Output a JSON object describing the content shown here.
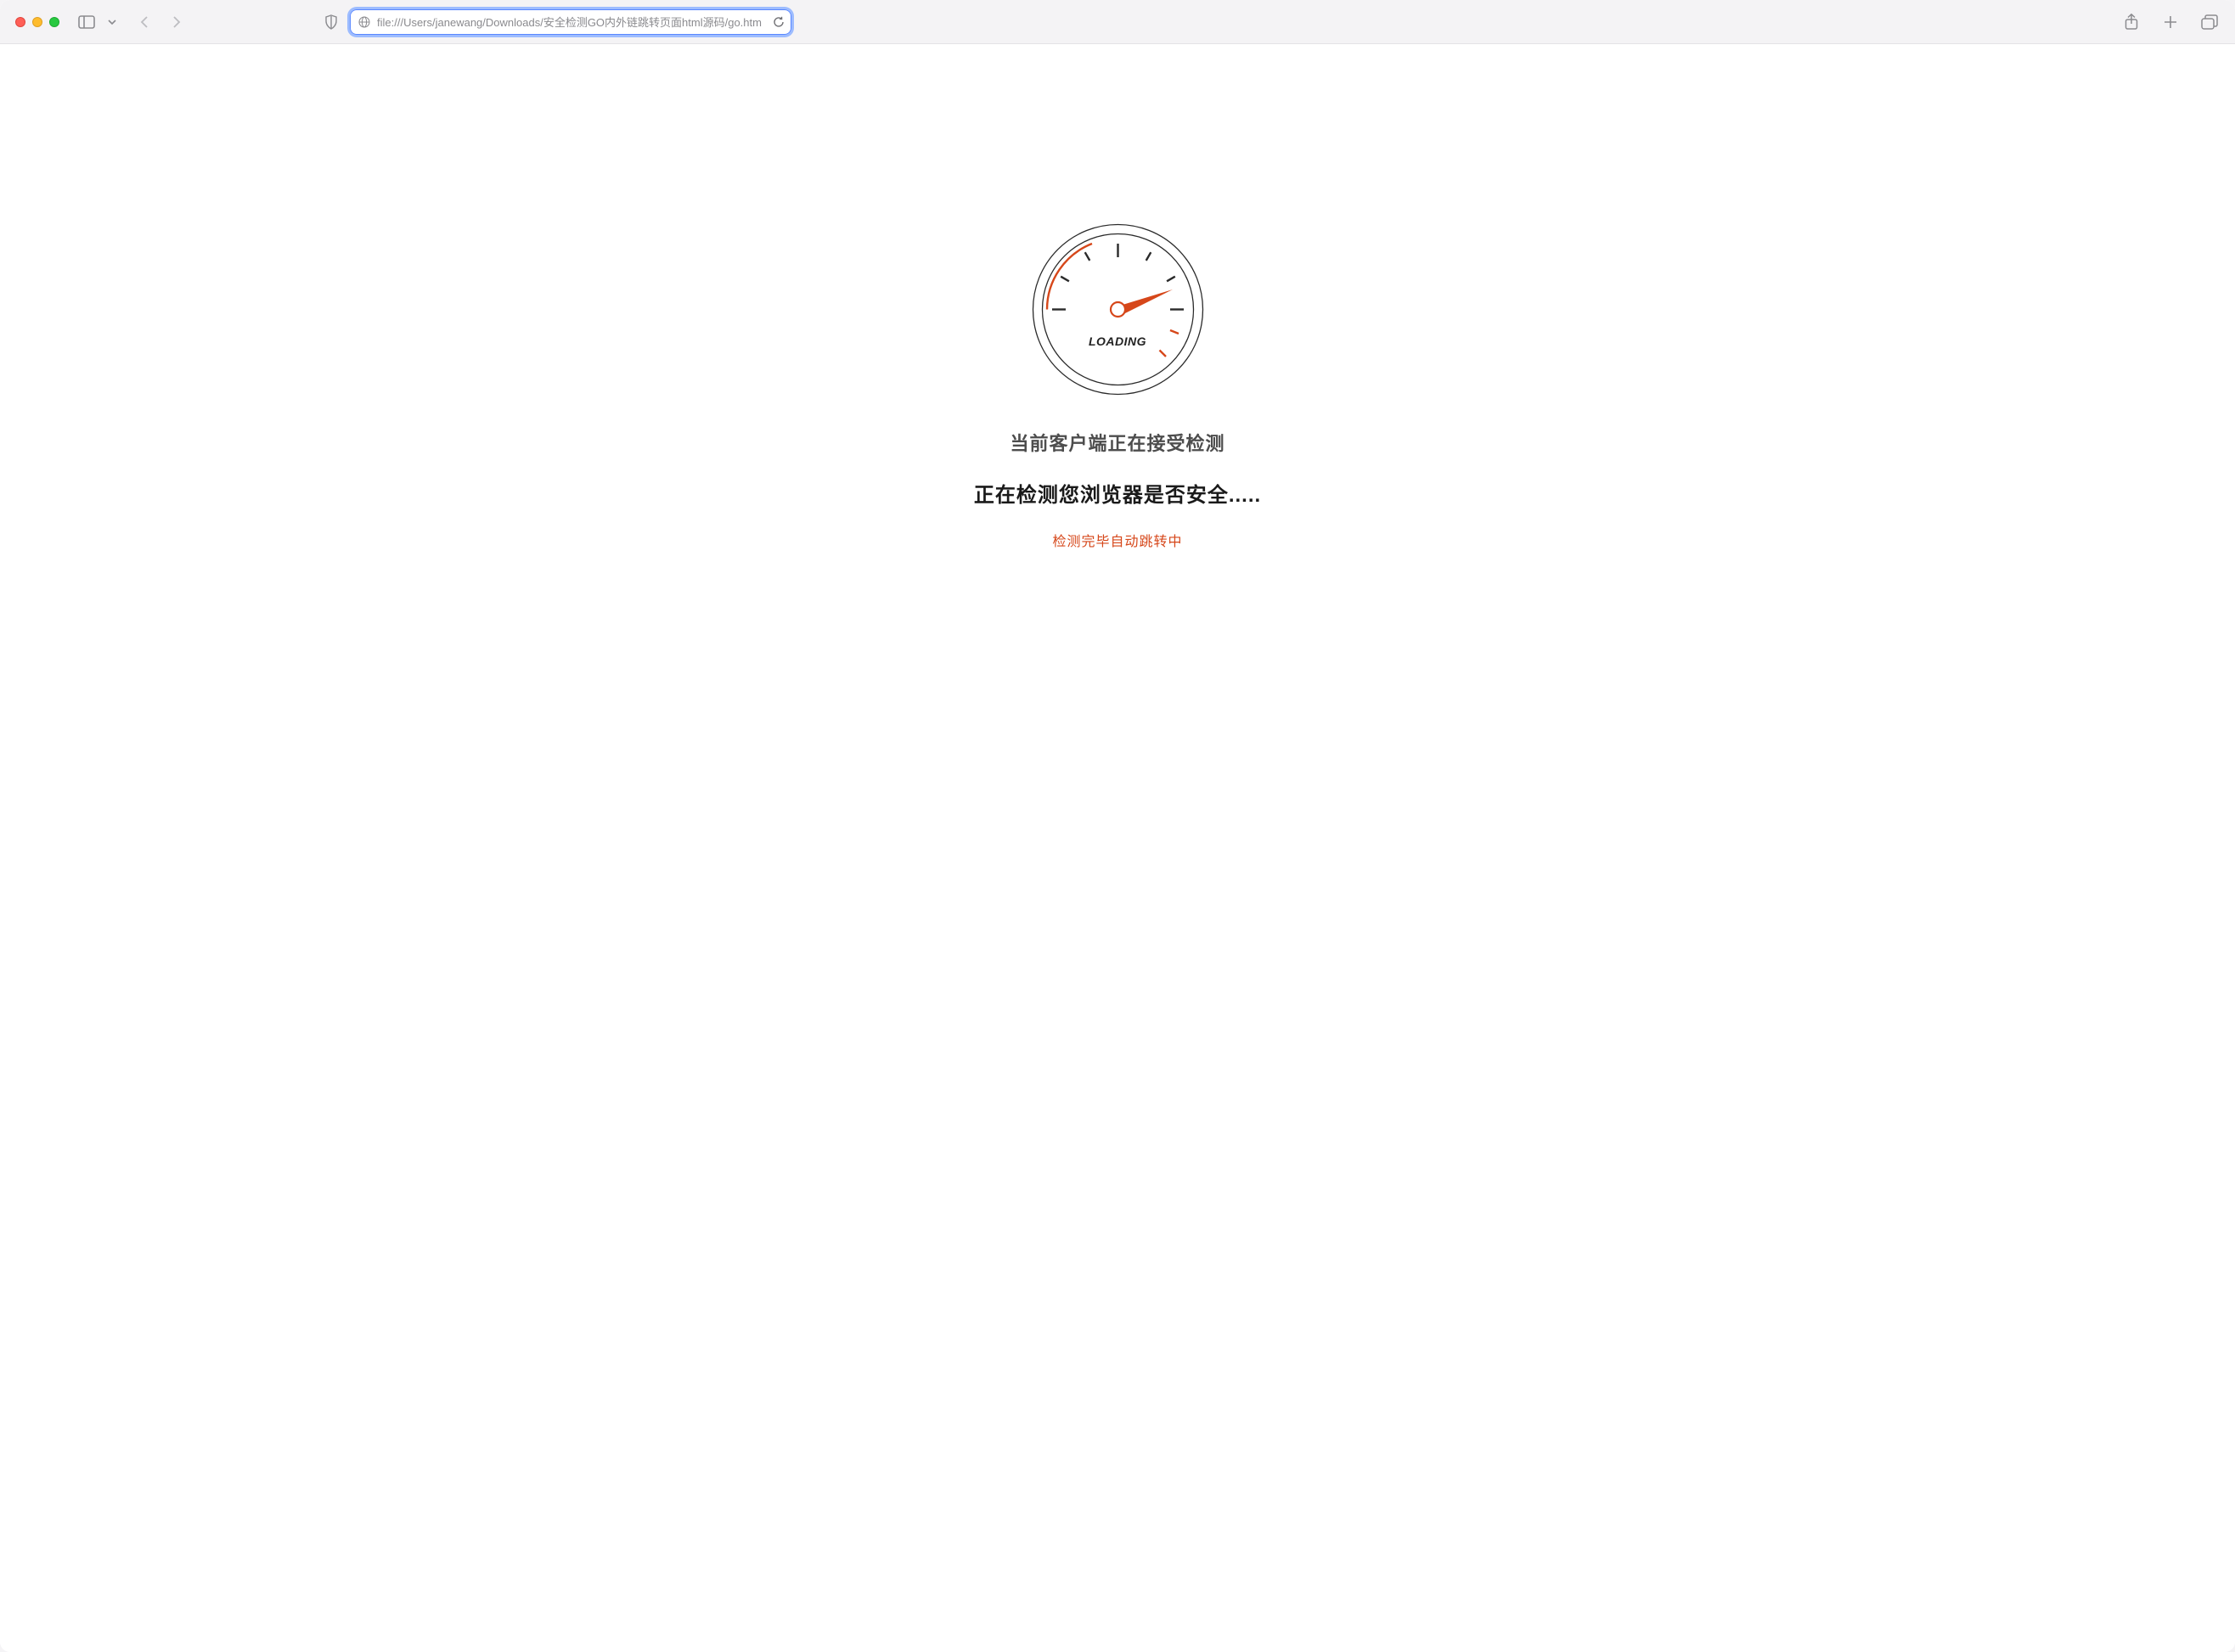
{
  "browser": {
    "url": "file:///Users/janewang/Downloads/安全检测GO内外链跳转页面html源码/go.htm"
  },
  "page": {
    "gauge_label": "LOADING",
    "heading_primary": "当前客户端正在接受检测",
    "heading_secondary": "正在检测您浏览器是否安全.....",
    "subtext": "检测完毕自动跳转中"
  },
  "colors": {
    "accent_red": "#d6471a",
    "text_dark": "#1a1a1a",
    "text_mid": "#4d4d4d"
  }
}
